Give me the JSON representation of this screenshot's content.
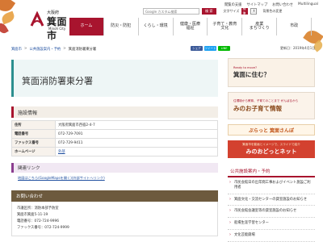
{
  "header": {
    "logo": {
      "prefecture": "大阪府",
      "city": "箕面市",
      "romaji": "Minoh City"
    },
    "util_links": [
      "閲覧の支援",
      "サイトマップ",
      "お問い合わせ",
      "Multilingual"
    ],
    "search": {
      "placeholder": "Google カスタム検索",
      "button": "検 索"
    },
    "font_size": {
      "label": "文字サイズ",
      "options": [
        "標準",
        "大"
      ],
      "selected": "標準"
    },
    "color_links": "背景色の変更"
  },
  "nav": [
    {
      "label": "ホーム"
    },
    {
      "label": "防災・防犯"
    },
    {
      "label": "くらし・環境"
    },
    {
      "label": "健康・医療\n福祉"
    },
    {
      "label": "子育て・教育\n文化"
    },
    {
      "label": "産業\nまちづくり"
    },
    {
      "label": "市政"
    }
  ],
  "breadcrumb": {
    "items": [
      "箕面市",
      "公共施設案内・予約",
      "箕面消防署東分署"
    ]
  },
  "share": {
    "facebook": "シェア",
    "twitter": "ツイート",
    "line": "LINE",
    "update": "更新日：2019年4月1日"
  },
  "page": {
    "title": "箕面消防署東分署"
  },
  "facility": {
    "heading": "施設情報",
    "rows": [
      {
        "label": "住所",
        "value": "大阪府箕面市西宿2-4-7"
      },
      {
        "label": "電話番号",
        "value": "072-729-7091"
      },
      {
        "label": "ファックス番号",
        "value": "072-729-9411"
      },
      {
        "label": "ホームページ",
        "value": "外部"
      }
    ]
  },
  "related": {
    "heading": "関連リンク",
    "link": "地図はこちら(GoogleMapsを開く)(外部サイトへリンク)"
  },
  "contact": {
    "heading": "お問い合わせ",
    "lines": [
      "市議区所：消防本部予防室",
      "箕面市箕面5-11-19",
      "電話番号：072-724-9996",
      "ファックス番号：072-724-9999"
    ]
  },
  "sidebar": {
    "banners": [
      {
        "small": "Ready to move?",
        "big": "箕面に住む？"
      },
      {
        "small": "住環境から教育、子育てのことまで がんばるから",
        "big": "みのお子育て情報"
      },
      {
        "small": "",
        "big": "ぶらっと 箕面さんぽ"
      },
      {
        "small": "箕面市を動画とイメージで、スライドで紹介",
        "big": "みのおどっとネット"
      }
    ],
    "menu_heading": "公共施設案内・予約",
    "menu_items": [
      "市民会館日の出年間工事およびイベント施設ご利用者",
      "箕面文化・交流センターの貸室施設のお知らせ",
      "市民会館会議室等の貸室施設のお知らせ",
      "船場生涯学習センター",
      "文化芸能劇場"
    ]
  },
  "colors": {
    "accent": "#a8142e",
    "teal": "#2c8f8f",
    "contact_bar": "#6d5a3e",
    "link": "#2050a0"
  }
}
